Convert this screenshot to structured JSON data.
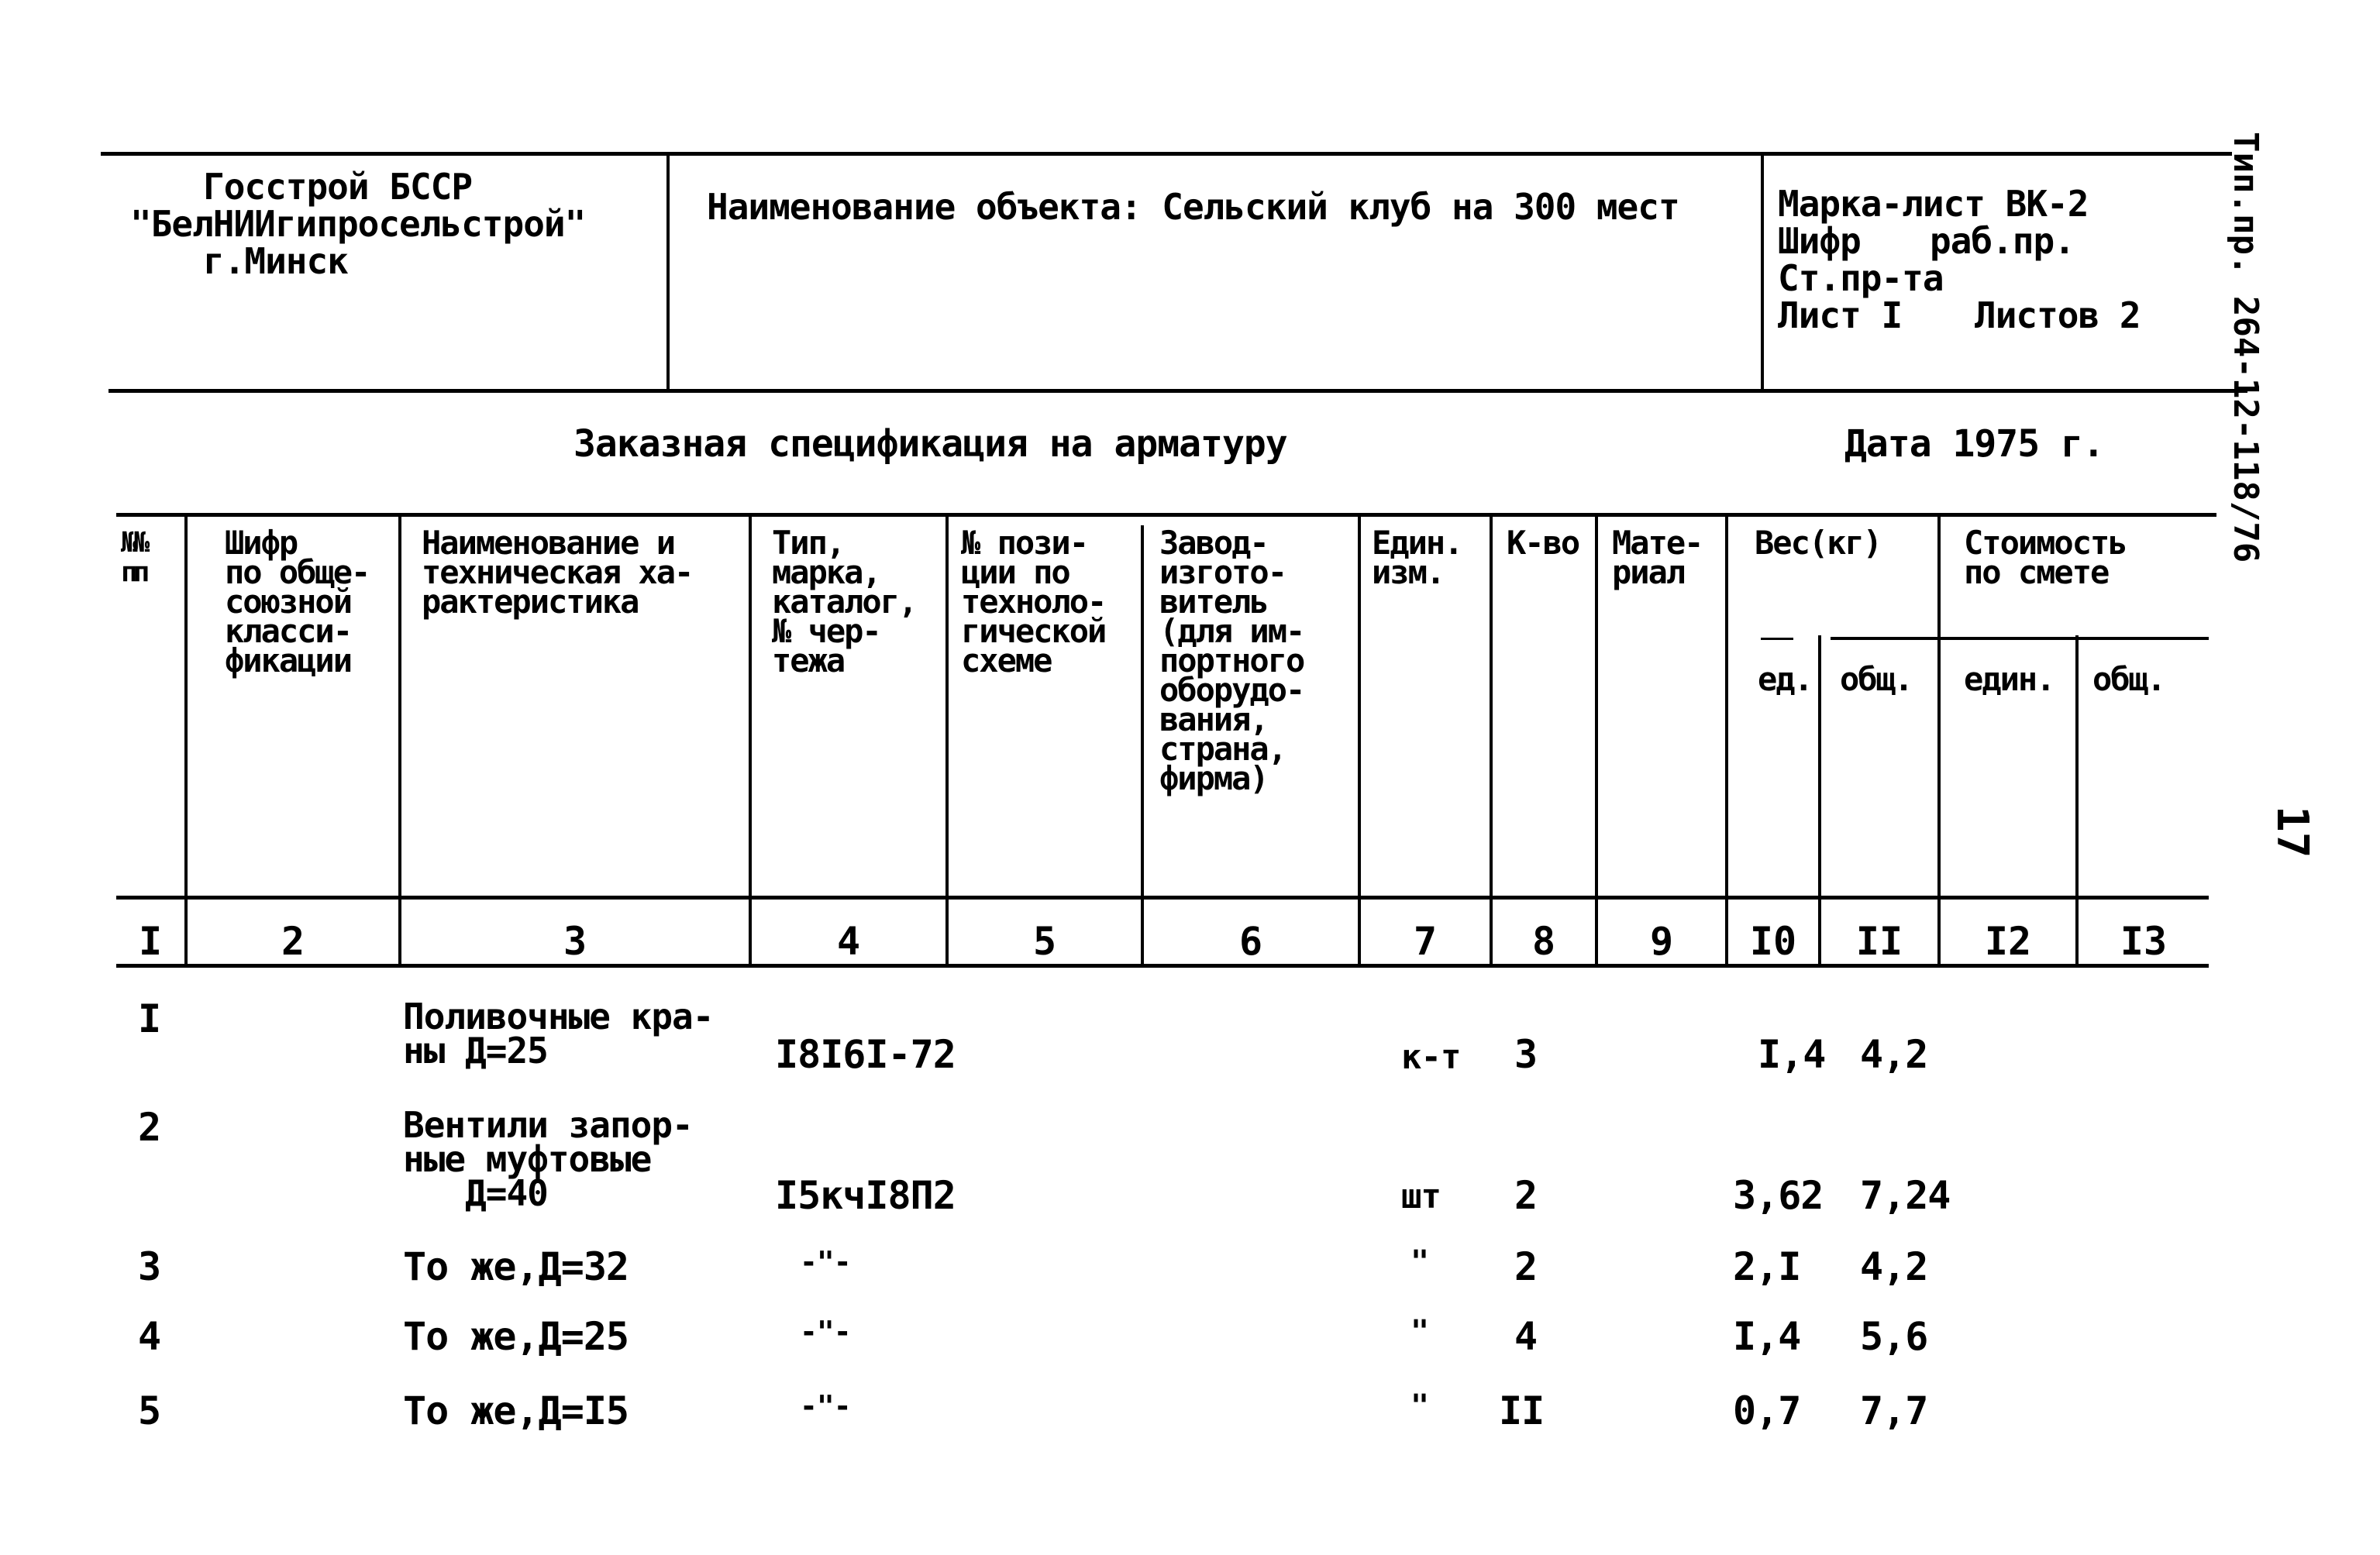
{
  "title_block": {
    "organization": [
      "Госстрой БССР",
      "\"БелНИИгипросельстрой\"",
      "г.Минск"
    ],
    "object_name": "Наименование объекта: Сельский клуб на 300 мест",
    "sheet_info": {
      "marka_list": "Марка-лист ВК-2",
      "shifr_label": "Шифр",
      "shifr_value": "раб.пр.",
      "stage": "Ст.пр-та",
      "sheet": "Лист I",
      "sheets_total": "Листов 2"
    }
  },
  "side_stamp": "Тип.пр. 264-12-118/76",
  "page_number": "17",
  "document_title": "Заказная спецификация на арматуру",
  "date": "Дата 1975 г.",
  "table": {
    "headers": [
      "№№\nпп",
      "Шифр\nпо обще-\nсоюзной\nкласси-\nфикации",
      "Наименование и\nтехническая ха-\nрактеристика",
      "Тип,\nмарка,\nкаталог,\n№ чер-\nтежа",
      "№ пози-\nции по\nтехноло-\nгической\nсхеме",
      "Завод-\nизгото-\nвитель\n(для им-\nпортного\nоборудо-\nвания,\nстрана,\nфирма)",
      "Един.\nизм.",
      "К-во",
      "Мате-\nриал"
    ],
    "weight_group": {
      "label": "Вес(кг)",
      "sub": [
        "ед.",
        "общ."
      ]
    },
    "cost_group": {
      "label": "Стоимость\nпо смете",
      "sub": [
        "един.",
        "общ."
      ]
    },
    "column_numbers": [
      "I",
      "2",
      "3",
      "4",
      "5",
      "6",
      "7",
      "8",
      "9",
      "I0",
      "II",
      "I2",
      "I3"
    ],
    "rows": [
      {
        "n": "I",
        "name": "Поливочные кра-\nны Д=25",
        "type": "I8I6I-72",
        "unit": "к-т",
        "qty": "3",
        "w_unit": "I,4",
        "w_total": "4,2"
      },
      {
        "n": "2",
        "name": "Вентили запор-\nные муфтовые\n   Д=40",
        "type": "I5кчI8П2",
        "unit": "шт",
        "qty": "2",
        "w_unit": "3,62",
        "w_total": "7,24"
      },
      {
        "n": "3",
        "name": "То же,Д=32",
        "type": "-\"-",
        "unit": "\"",
        "qty": "2",
        "w_unit": "2,I",
        "w_total": "4,2"
      },
      {
        "n": "4",
        "name": "То же,Д=25",
        "type": "-\"-",
        "unit": "\"",
        "qty": "4",
        "w_unit": "I,4",
        "w_total": "5,6"
      },
      {
        "n": "5",
        "name": "То же,Д=I5",
        "type": "-\"-",
        "unit": "\"",
        "qty": "II",
        "w_unit": "0,7",
        "w_total": "7,7"
      }
    ]
  }
}
